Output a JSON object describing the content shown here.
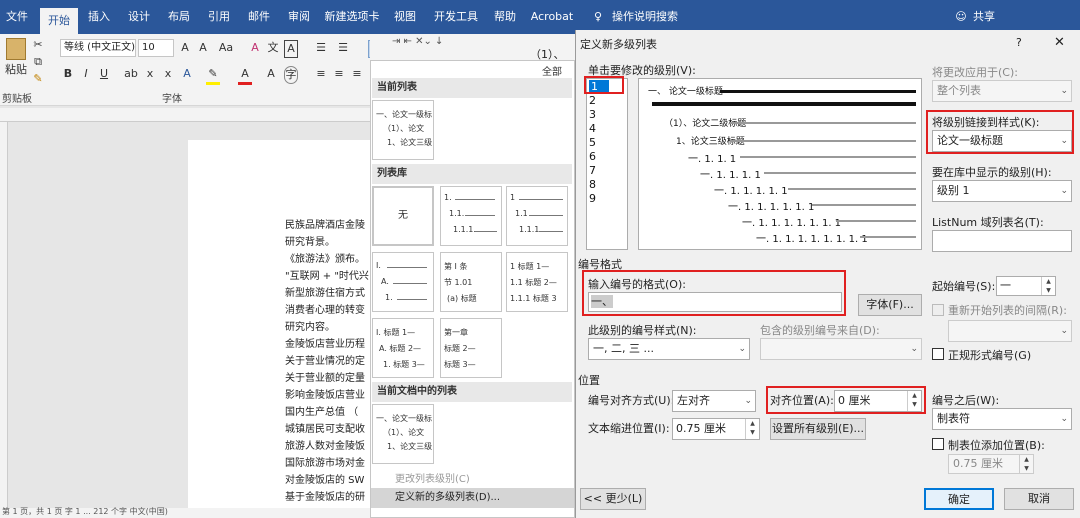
{
  "ribbon": {
    "tabs": [
      "文件",
      "开始",
      "插入",
      "设计",
      "布局",
      "引用",
      "邮件",
      "审阅",
      "新建选项卡",
      "视图",
      "开发工具",
      "帮助",
      "Acrobat"
    ],
    "active_tab": "开始",
    "search": "操作说明搜索",
    "share": "共享",
    "paste": "粘贴",
    "clipboard": "剪贴板",
    "font_name": "等线 (中文正文)",
    "font_size": "10",
    "font_group": "字体",
    "partial_number": "（1）、"
  },
  "document": {
    "lines": [
      "民族品牌酒店金陵",
      "研究背景。",
      "《旅游法》颁布。",
      "\"互联网 + \"时代兴",
      "新型旅游住宿方式",
      "消费者心理的转变",
      "研究内容。",
      "金陵饭店营业历程",
      "关于营业情况的定",
      "关于营业额的定量",
      "影响金陵饭店营业",
      "国内生产总值 （",
      "城镇居民可支配收",
      "旅游人数对金陵饭",
      "国际旅游市场对金",
      "对金陵饭店的 SW",
      "基于金陵饭店的研"
    ],
    "status": "第 1 页，共 1 页    字 1 ... 212 个字    中文(中国)"
  },
  "gallery": {
    "all": "全部",
    "current_list": "当前列表",
    "library": "列表库",
    "in_doc": "当前文档中的列表",
    "none": "无",
    "sample_l1": "一、论文一级标",
    "sample_l2": "（1）、论文",
    "sample_l3": "1、论文三级",
    "heading_label": "标题",
    "chapter": "第一章",
    "section": "节 1.01",
    "part": "第 Ⅰ 条",
    "sub_a": "(a) 标题",
    "menu_change": "更改列表级别(C)",
    "menu_define": "定义新的多级列表(D)..."
  },
  "dialog": {
    "title": "定义新多级列表",
    "help": "?",
    "close": "✕",
    "click_level": "单击要修改的级别(V):",
    "levels": [
      "1",
      "2",
      "3",
      "4",
      "5",
      "6",
      "7",
      "8",
      "9"
    ],
    "selected_level": "1",
    "apply_to_label": "将更改应用于(C):",
    "apply_to_value": "整个列表",
    "link_style_label": "将级别链接到样式(K):",
    "link_style_value": "论文一级标题",
    "gallery_level_label": "要在库中显示的级别(H):",
    "gallery_level_value": "级别 1",
    "listnum_label": "ListNum 域列表名(T):",
    "preview": [
      "一、 论文一级标题",
      "（1）、论文二级标题",
      "1、论文三级标题",
      "一. 1. 1. 1",
      "一. 1. 1. 1. 1",
      "一. 1. 1. 1. 1. 1",
      "一. 1. 1. 1. 1. 1. 1",
      "一. 1. 1. 1. 1. 1. 1. 1",
      "一. 1. 1. 1. 1. 1. 1. 1. 1"
    ],
    "number_format_section": "编号格式",
    "enter_format_label": "输入编号的格式(O):",
    "format_value": "一、",
    "font_button": "字体(F)...",
    "number_style_label": "此级别的编号样式(N):",
    "number_style_value": "一, 二, 三 ...",
    "include_from_label": "包含的级别编号来自(D):",
    "start_at_label": "起始编号(S):",
    "start_at_value": "一",
    "restart_label": "重新开始列表的间隔(R):",
    "legal_label": "正规形式编号(G)",
    "position_section": "位置",
    "align_label": "编号对齐方式(U):",
    "align_value": "左对齐",
    "aligned_at_label": "对齐位置(A):",
    "aligned_at_value": "0 厘米",
    "follow_label": "编号之后(W):",
    "follow_value": "制表符",
    "indent_label": "文本缩进位置(I):",
    "indent_value": "0.75 厘米",
    "set_all_button": "设置所有级别(E)...",
    "tabstop_label": "制表位添加位置(B):",
    "tabstop_value": "0.75 厘米",
    "less_button": "<< 更少(L)",
    "ok_button": "确定",
    "cancel_button": "取消"
  },
  "colors": {
    "ribbon": "#2b579a",
    "highlight": "#e02020",
    "ok_border": "#0078d7"
  }
}
